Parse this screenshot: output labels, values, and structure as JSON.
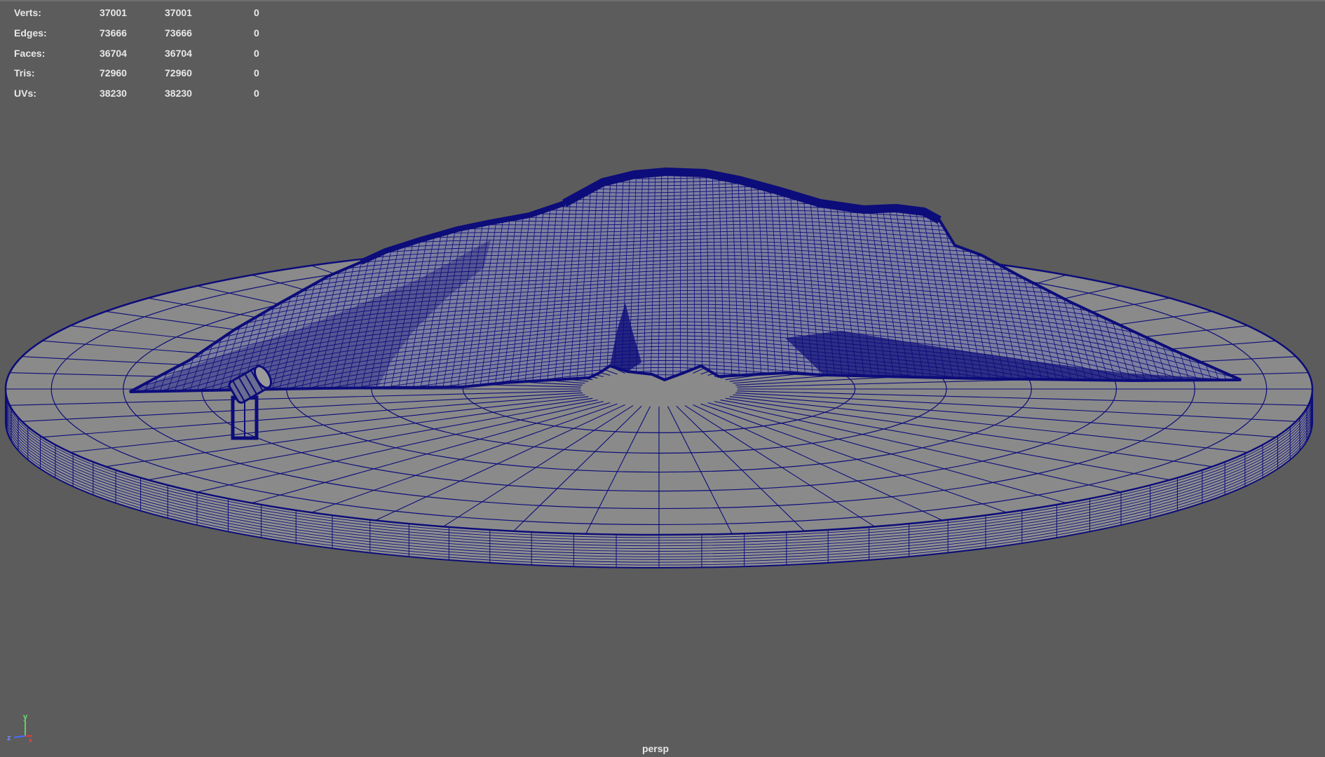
{
  "viewport": {
    "camera": "persp",
    "background_color": "#5c5c5c",
    "wire_color": "#0c0c7a",
    "surface_color": "#8a8a8a"
  },
  "hud": {
    "rows": [
      {
        "label": "Verts:",
        "v1": "37001",
        "v2": "37001",
        "v3": "0"
      },
      {
        "label": "Edges:",
        "v1": "73666",
        "v2": "73666",
        "v3": "0"
      },
      {
        "label": "Faces:",
        "v1": "36704",
        "v2": "36704",
        "v3": "0"
      },
      {
        "label": "Tris:",
        "v1": "72960",
        "v2": "72960",
        "v3": "0"
      },
      {
        "label": "UVs:",
        "v1": "38230",
        "v2": "38230",
        "v3": "0"
      }
    ]
  },
  "axis": {
    "x": "x",
    "y": "y",
    "z": "z"
  },
  "scene_objects": {
    "base": "cylinder-base-wireframe",
    "cloth": "draped-cloth-wireframe",
    "prop": "spotlight-prop-wireframe"
  }
}
